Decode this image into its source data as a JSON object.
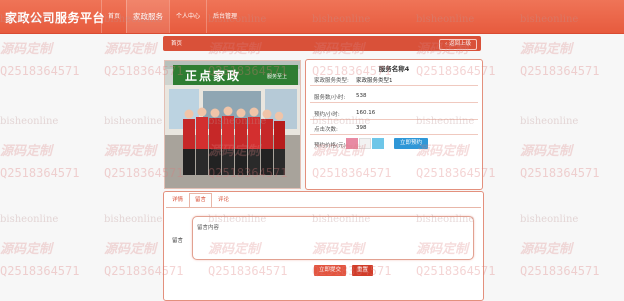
{
  "header": {
    "brand": "家政公司服务平台",
    "nav": [
      {
        "label": "首页"
      },
      {
        "label": "家政服务"
      },
      {
        "label": "个人中心"
      },
      {
        "label": "后台管理"
      }
    ]
  },
  "title_strip": {
    "heading": "首页",
    "back_label": "返回上级"
  },
  "image": {
    "sign_text": "正点家政",
    "sign_sub": "服务至上"
  },
  "detail": {
    "title": "服务名称4",
    "rows": [
      {
        "label": "家政服务类型:",
        "value": "家政服务类型1"
      },
      {
        "label": "服务数/小时:",
        "value": "538"
      },
      {
        "label": "预约/小时:",
        "value": "160.16"
      },
      {
        "label": "点击次数:",
        "value": "398"
      }
    ],
    "rate_label": "预约价格(元):",
    "submit_label": "立即预约"
  },
  "tabs": [
    {
      "label": "详情"
    },
    {
      "label": "留言"
    },
    {
      "label": "评论"
    }
  ],
  "comment": {
    "label": "留言",
    "placeholder": "留言内容"
  },
  "buttons": {
    "submit": "立即提交",
    "reset": "重置"
  },
  "watermark": {
    "site": "bisheonline",
    "brand": "源码定制",
    "qq": "Q2518364571"
  },
  "colors": {
    "accent": "#e75b3e",
    "accent_dark": "#d95139",
    "link_blue": "#2f97d7"
  }
}
